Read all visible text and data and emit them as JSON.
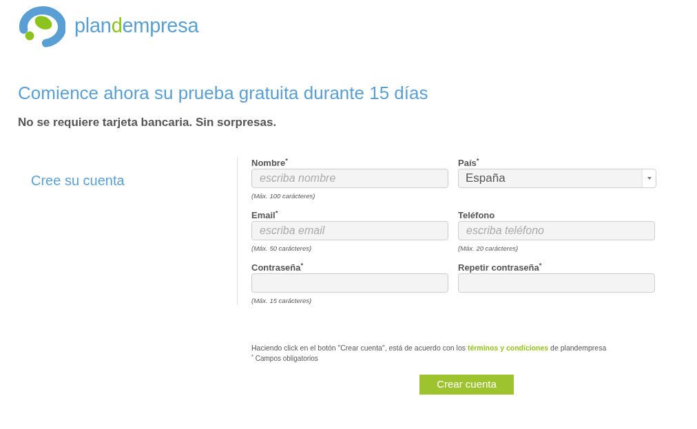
{
  "logo": {
    "parts": [
      {
        "text": "plan",
        "accent": false
      },
      {
        "text": "d",
        "accent": true
      },
      {
        "text": "empresa",
        "accent": false
      }
    ]
  },
  "heading": "Comience ahora su prueba gratuita durante 15 días",
  "subheading": "No se requiere tarjeta bancaria. Sin sorpresas.",
  "section_title": "Cree su cuenta",
  "form": {
    "fields": [
      {
        "kind": "text",
        "label": "Nombre$^{*}$",
        "placeholder": "escriba nombre",
        "hint": "(Máx. 100 carácteres)"
      },
      {
        "kind": "select",
        "label": "País$^{*}$",
        "value": "España"
      },
      {
        "kind": "text",
        "label": "Email$^{*}$",
        "placeholder": "escriba email",
        "hint": "(Máx. 50 carácteres)"
      },
      {
        "kind": "text",
        "label": "Teléfono",
        "placeholder": "escriba teléfono",
        "hint": "(Máx. 20 carácteres)"
      },
      {
        "kind": "password",
        "label": "Contraseña$^{*}$",
        "hint": "(Máx. 15 carácteres)"
      },
      {
        "kind": "password",
        "label": "Repetir contraseña$^{*}$"
      }
    ]
  },
  "terms": {
    "before": "Haciendo click en el botón \"Crear cuenta\", está de acuerdo con los",
    "link": "términos y condiciones",
    "after": "de plandempresa"
  },
  "required_note": "$^{*}$ Campos obligatorios",
  "submit_button": "Crear cuenta"
}
